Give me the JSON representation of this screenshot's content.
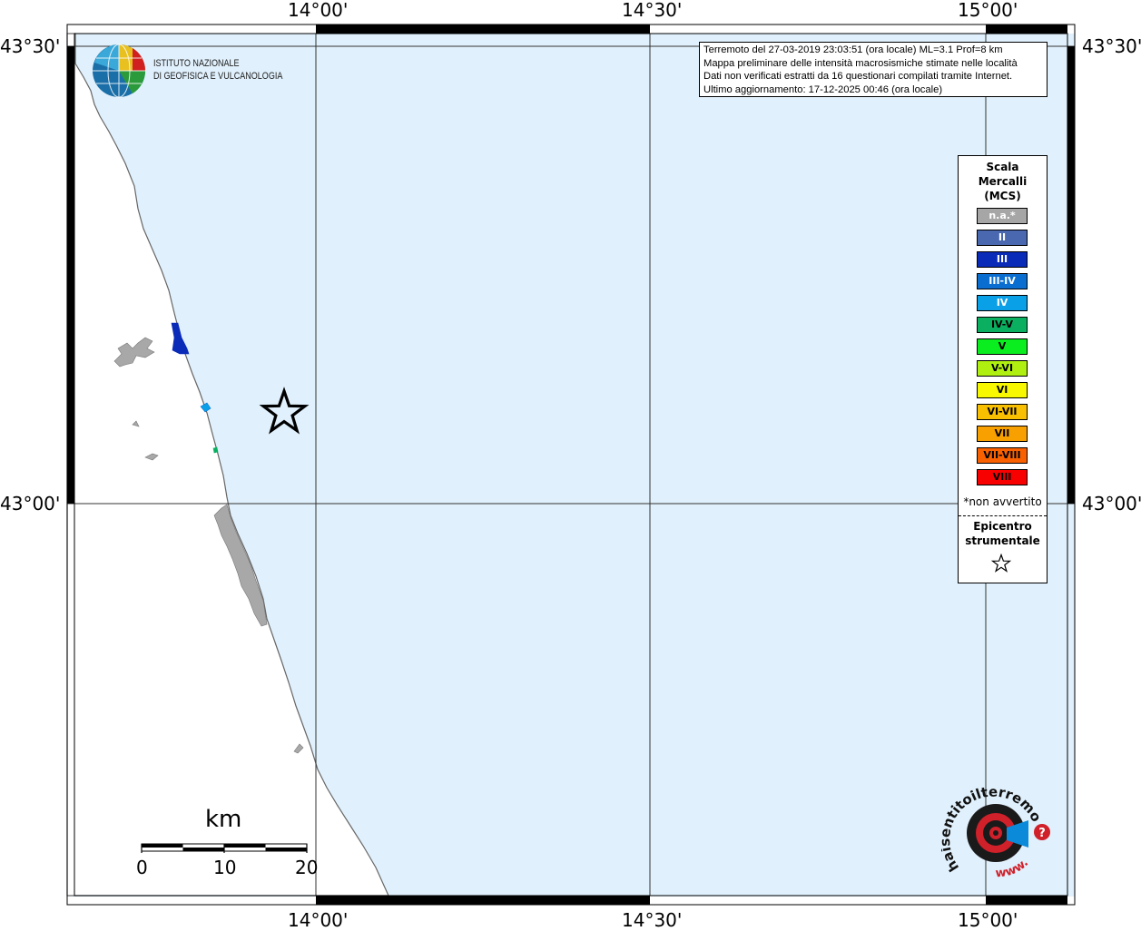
{
  "map": {
    "title_lines": [
      "Terremoto del 27-03-2019 23:03:51 (ora locale) ML=3.1 Prof=8 km",
      "Mappa preliminare delle intensità macrosismiche stimate nelle località",
      "Dati non verificati estratti da 16 questionari compilati tramite Internet.",
      "Ultimo aggiornamento: 17-12-2025 00:46 (ora locale)"
    ],
    "colors": {
      "sea": "#e0f0fc",
      "land": "#ffffff",
      "coast": "#666666",
      "felt_gray": "#aaaaaa"
    },
    "grid": {
      "lon_labels_top": [
        "14°00'",
        "14°30'",
        "15°00'"
      ],
      "lon_labels_bottom": [
        "14°00'",
        "14°30'",
        "15°00'"
      ],
      "lat_labels_left": [
        "43°30'",
        "43°00'"
      ],
      "lat_labels_right": [
        "43°30'",
        "43°00'"
      ]
    },
    "epicenter_icon": "star-icon"
  },
  "logos": {
    "ingv_line1": "ISTITUTO NAZIONALE",
    "ingv_line2": "DI GEOFISICA E VULCANOLOGIA",
    "hsit_text": "haisentitoilterremoto.it",
    "hsit_prefix": "www.",
    "hsit_question": "?"
  },
  "legend": {
    "title_line1": "Scala",
    "title_line2": "Mercalli",
    "title_line3": "(MCS)",
    "items": [
      {
        "label": "n.a.*",
        "color": "#a6a6a6",
        "text_color": "#ffffff"
      },
      {
        "label": "II",
        "color": "#4a68b0",
        "text_color": "#ffffff"
      },
      {
        "label": "III",
        "color": "#0a2ab8",
        "text_color": "#ffffff"
      },
      {
        "label": "III-IV",
        "color": "#0a6ed0",
        "text_color": "#ffffff"
      },
      {
        "label": "IV",
        "color": "#0aa0e8",
        "text_color": "#ffffff"
      },
      {
        "label": "IV-V",
        "color": "#0ab060",
        "text_color": "#000000"
      },
      {
        "label": "V",
        "color": "#0aee20",
        "text_color": "#000000"
      },
      {
        "label": "V-VI",
        "color": "#b0f010",
        "text_color": "#000000"
      },
      {
        "label": "VI",
        "color": "#f8f800",
        "text_color": "#000000"
      },
      {
        "label": "VI-VII",
        "color": "#f8c000",
        "text_color": "#000000"
      },
      {
        "label": "VII",
        "color": "#f8a000",
        "text_color": "#000000"
      },
      {
        "label": "VII-VIII",
        "color": "#f86000",
        "text_color": "#000000"
      },
      {
        "label": "VIII",
        "color": "#f80000",
        "text_color": "#000000"
      }
    ],
    "note": "*non avvertito",
    "epicenter_line1": "Epicentro",
    "epicenter_line2": "strumentale"
  },
  "scalebar": {
    "unit": "km",
    "ticks": [
      "0",
      "10",
      "20"
    ]
  }
}
